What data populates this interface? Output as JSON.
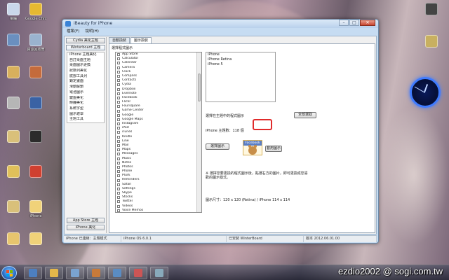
{
  "desktop": {
    "icons": [
      {
        "label": "電腦",
        "color": "#c9d7ea"
      },
      {
        "label": "Google Chrome",
        "color": "#e6b931"
      },
      {
        "label": "",
        "color": "#6a8fbf"
      },
      {
        "label": "資源回收筒",
        "color": "#9ab3cf"
      },
      {
        "label": "",
        "color": "#d8b05c"
      },
      {
        "label": "",
        "color": "#c46b3c"
      },
      {
        "label": "",
        "color": "#b6b6b6"
      },
      {
        "label": "",
        "color": "#3a62a4"
      },
      {
        "label": "",
        "color": "#d9c07a"
      },
      {
        "label": "",
        "color": "#2b2b2b"
      },
      {
        "label": "",
        "color": "#e0c05a"
      },
      {
        "label": "",
        "color": "#d04030"
      },
      {
        "label": "",
        "color": "#d9c07a"
      },
      {
        "label": "iPhone",
        "color": "#f0d279"
      },
      {
        "label": "",
        "color": "#e7c56e"
      },
      {
        "label": "",
        "color": "#f0d279"
      },
      {
        "label": "",
        "color": "#444"
      },
      {
        "label": "",
        "color": "#c8b060"
      }
    ]
  },
  "window": {
    "title": "iBeauty for iPhone",
    "menu": [
      "檔案(F)",
      "說明(H)"
    ],
    "minimize": "–",
    "maximize": "□",
    "close": "✕"
  },
  "left_panel": {
    "top_buttons": [
      "Cydia 美化主題",
      "Winterboard 主題"
    ],
    "items": [
      "iPhone 主題美化",
      "自訂桌面主題",
      "桌面圖示更換",
      "狀態列美化",
      "底部工具列",
      "鎖定畫面",
      "滑動解鎖",
      "電池圖示",
      "鍵盤美化",
      "時鐘美化",
      "系統字型",
      "圖示遮罩",
      "主題工具"
    ],
    "bottom_buttons": [
      "App Store 主題",
      "iPhone 美化"
    ]
  },
  "tabs": [
    "自動換裝",
    "圖示換裝"
  ],
  "tab_section_label": "選擇程式圖示",
  "apps": [
    "App Store",
    "Calculator",
    "Calendar",
    "Camera",
    "Clock",
    "Compass",
    "Contacts",
    "Cydia",
    "Dropbox",
    "Evernote",
    "Facebook",
    "Flickr",
    "Foursquare",
    "Game Center",
    "Google",
    "Google Maps",
    "Instagram",
    "iPod",
    "iTunes",
    "Kindle",
    "Line",
    "Mail",
    "Maps",
    "Messages",
    "Music",
    "Notes",
    "Photos",
    "Phone",
    "Plurk",
    "Reminders",
    "Safari",
    "Settings",
    "Skype",
    "Stocks",
    "Twitter",
    "Videos",
    "Voice Memos",
    "Weather",
    "WhatsApp",
    "YouTube"
  ],
  "devices": [
    "iPhone",
    "iPhone Retina",
    "iPhone 5"
  ],
  "options_label": "選擇在主題中的程式圖示",
  "buttons": {
    "select_all": "全部選取",
    "change_icon": "選擇圖示",
    "apply_icon": "套用圖示"
  },
  "count_text": "iPhone 主題數：118 個",
  "facebook_label": "Facebook",
  "note": "※ 選擇您要更換的程式圖示後，點選右方的圖片，即可更換成您喜歡的圖示樣式。",
  "resolution_text": "圖示尺寸：120 x 120 (Retina) / iPhone 114 x 114",
  "status": {
    "device": "iPhone 已連線：主題模式",
    "version": "iPhone OS 6.0.1",
    "mode": "已安裝 WinterBoard",
    "date": "版本 2012.06.01.00"
  },
  "taskbar": {
    "apps": [
      {
        "color": "#4d7fc0"
      },
      {
        "color": "#e4b84a"
      },
      {
        "color": "#7aa3d0"
      },
      {
        "color": "#c77a3a"
      },
      {
        "color": "#5a8cc2"
      },
      {
        "color": "#c55"
      },
      {
        "color": "#8ab"
      }
    ]
  },
  "watermark": "ezdio2002 @ sogi.com.tw"
}
